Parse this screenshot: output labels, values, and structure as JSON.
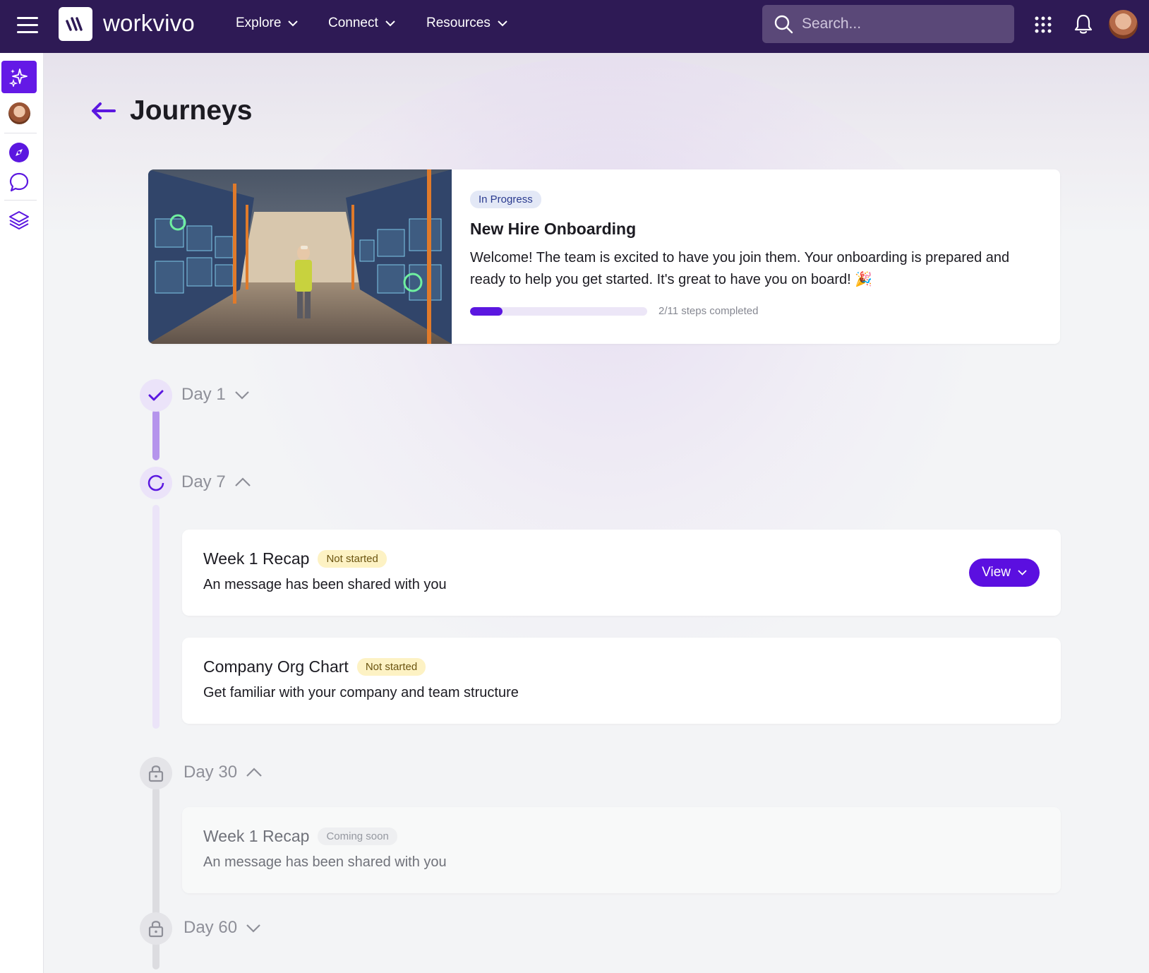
{
  "app": {
    "logo_text": "workvivo"
  },
  "nav": {
    "items": [
      {
        "label": "Explore"
      },
      {
        "label": "Connect"
      },
      {
        "label": "Resources"
      }
    ],
    "search_placeholder": "Search..."
  },
  "page": {
    "title": "Journeys"
  },
  "journey": {
    "status": "In Progress",
    "title": "New Hire Onboarding",
    "description": "Welcome! The team is excited to have you join them. Your onboarding is prepared and ready to help you get started. It's great to have you on board! 🎉",
    "progress_text": "2/11 steps completed",
    "progress_fraction": 0.1818
  },
  "days": [
    {
      "label": "Day 1",
      "state": "completed",
      "expanded": false
    },
    {
      "label": "Day 7",
      "state": "in-progress",
      "expanded": true,
      "tasks": [
        {
          "title": "Week 1 Recap",
          "status": "Not started",
          "description": "An message has been shared with you",
          "action": "View"
        },
        {
          "title": "Company Org Chart",
          "status": "Not started",
          "description": "Get familiar with your company and team structure"
        }
      ]
    },
    {
      "label": "Day 30",
      "state": "locked",
      "expanded": true,
      "tasks": [
        {
          "title": "Week 1 Recap",
          "status": "Coming soon",
          "description": "An message has been shared with you"
        }
      ]
    },
    {
      "label": "Day 60",
      "state": "locked",
      "expanded": false
    }
  ],
  "colors": {
    "topbar": "#2e1a55",
    "accent": "#5b17e0",
    "in_progress_badge": "#e3e8f6",
    "not_started_badge": "#fdf2c4"
  },
  "icons": {
    "menu": "hamburger-icon",
    "search": "search-icon",
    "apps": "grid-icon",
    "notifications": "bell-icon",
    "ai": "sparkles-icon",
    "explore": "compass-icon",
    "chat": "chat-bubble-icon",
    "layers": "layers-icon",
    "back": "arrow-left-icon",
    "lock": "lock-icon",
    "check": "check-icon"
  }
}
